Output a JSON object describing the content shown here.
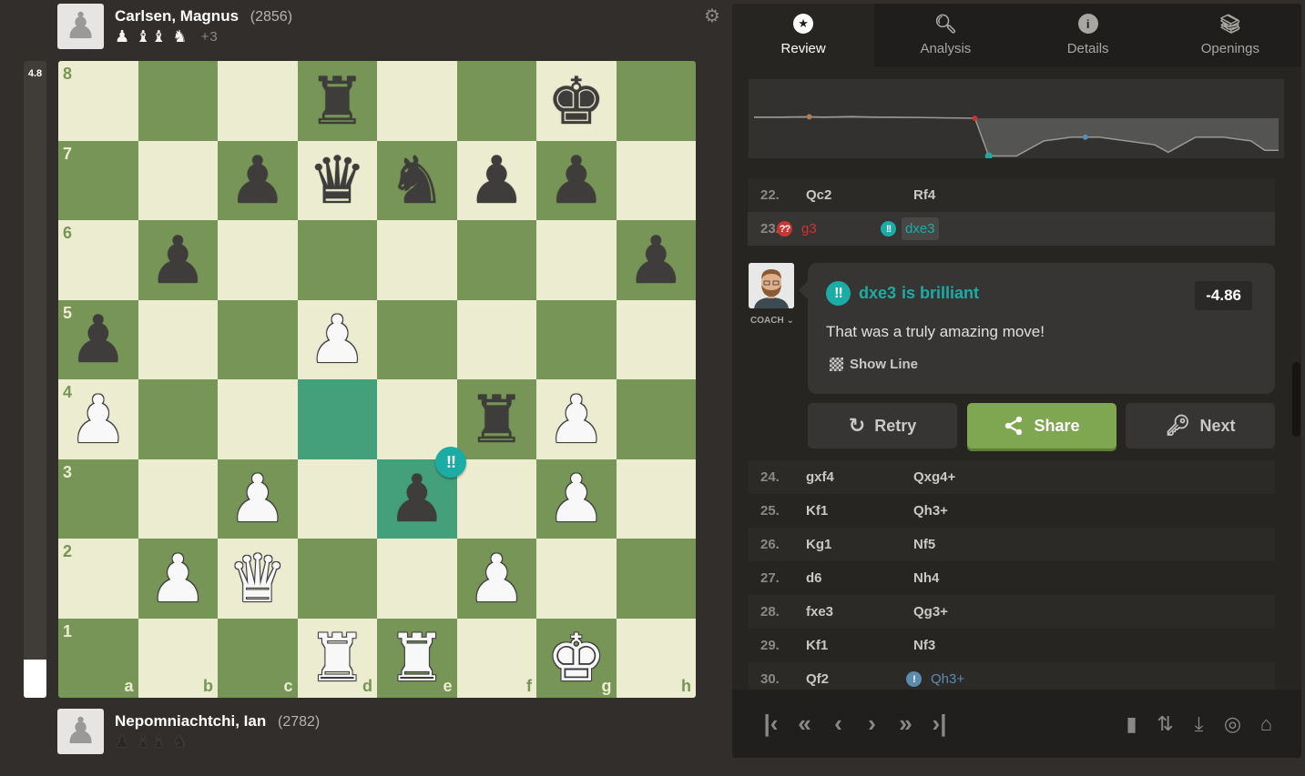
{
  "players": {
    "top": {
      "name": "Carlsen, Magnus",
      "rating": "(2856)",
      "captured": [
        "pawn",
        "bishops",
        "knight"
      ],
      "captured_glyphs": [
        "♟",
        "♝♝",
        "♞"
      ],
      "advantage": "+3"
    },
    "bottom": {
      "name": "Nepomniachtchi, Ian",
      "rating": "(2782)",
      "captured": [
        "pawn",
        "bishops",
        "knight"
      ],
      "captured_glyphs": [
        "♟",
        "♝♝",
        "♞"
      ]
    }
  },
  "eval_bar": {
    "label": "4.8",
    "white_fraction": 0.06
  },
  "board": {
    "files": [
      "a",
      "b",
      "c",
      "d",
      "e",
      "f",
      "g",
      "h"
    ],
    "ranks": [
      "8",
      "7",
      "6",
      "5",
      "4",
      "3",
      "2",
      "1"
    ],
    "highlight_squares": [
      "d4",
      "e3"
    ],
    "move_badge": {
      "square": "e3",
      "glyph": "!!",
      "type": "brilliant"
    },
    "pieces": {
      "d8": "bR",
      "g8": "bK",
      "c7": "bP",
      "d7": "bQ",
      "e7": "bN",
      "f7": "bP",
      "g7": "bP",
      "b6": "bP",
      "h6": "bP",
      "a5": "bP",
      "d5": "wP",
      "a4": "wP",
      "f4": "bR",
      "g4": "wP",
      "c3": "wP",
      "e3": "bP",
      "g3": "wP",
      "b2": "wP",
      "c2": "wQ",
      "f2": "wP",
      "d1": "wR",
      "e1": "wR",
      "g1": "wK"
    }
  },
  "tabs": [
    {
      "label": "Review",
      "icon": "star-icon",
      "active": true
    },
    {
      "label": "Analysis",
      "icon": "magnifier-icon",
      "active": false
    },
    {
      "label": "Details",
      "icon": "info-icon",
      "active": false
    },
    {
      "label": "Openings",
      "icon": "book-stack-icon",
      "active": false
    }
  ],
  "moves_top": [
    {
      "num": "22.",
      "white": "Qc2",
      "black": "Rf4"
    },
    {
      "num": "23.",
      "white": "g3",
      "white_glyph": "??",
      "white_class": "blunder",
      "black": "dxe3",
      "black_glyph": "!!",
      "black_class": "brilliant",
      "selected": "black"
    }
  ],
  "coach": {
    "label": "COACH",
    "title_move": "dxe3",
    "title_text": "is brilliant",
    "glyph": "!!",
    "eval": "-4.86",
    "message": "That was a truly amazing move!",
    "show_line": "Show Line"
  },
  "actions": {
    "retry": "Retry",
    "share": "Share",
    "next": "Next"
  },
  "moves_bottom": [
    {
      "num": "24.",
      "white": "gxf4",
      "black": "Qxg4+"
    },
    {
      "num": "25.",
      "white": "Kf1",
      "black": "Qh3+"
    },
    {
      "num": "26.",
      "white": "Kg1",
      "black": "Nf5"
    },
    {
      "num": "27.",
      "white": "d6",
      "black": "Nh4"
    },
    {
      "num": "28.",
      "white": "fxe3",
      "black": "Qg3+"
    },
    {
      "num": "29.",
      "white": "Kf1",
      "black": "Nf3"
    },
    {
      "num": "30.",
      "white": "Qf2",
      "black": "Qh3+",
      "black_glyph": "!",
      "black_class": "great"
    }
  ],
  "colors": {
    "brilliant": "#1baca6",
    "blunder": "#ca3431",
    "great": "#5c8bb0",
    "share_green": "#7fa650",
    "light_square": "#ebecd0",
    "dark_square": "#779556",
    "highlight": "#44a07a"
  },
  "eval_graph": {
    "points": [
      0.3,
      0.3,
      0.3,
      0.35,
      0.4,
      0.3,
      0.35,
      0.45,
      0.35,
      0.3,
      0.3,
      0.25,
      0.2,
      0.15,
      0.1,
      0.05,
      0.0,
      -10,
      -10,
      -10,
      -8,
      -6,
      -5.5,
      -5,
      -5,
      -5,
      -5.5,
      -6,
      -6.5,
      -7,
      -9,
      -7,
      -5,
      -5,
      -5,
      -5.5,
      -6,
      -8.5,
      -8.5
    ],
    "markers": [
      {
        "index": 4,
        "type": "inaccuracy",
        "color": "#b07b4f"
      },
      {
        "index": 16,
        "type": "blunder",
        "color": "#ca3431"
      },
      {
        "index": 17,
        "type": "brilliant",
        "color": "#1baca6"
      },
      {
        "index": 24,
        "type": "great",
        "color": "#5c8bb0"
      }
    ]
  },
  "footer": {
    "nav": [
      {
        "name": "first-move-button",
        "glyph": "|‹"
      },
      {
        "name": "back-5-button",
        "glyph": "«"
      },
      {
        "name": "prev-move-button",
        "glyph": "‹"
      },
      {
        "name": "next-move-button",
        "glyph": "›"
      },
      {
        "name": "forward-5-button",
        "glyph": "»"
      },
      {
        "name": "last-move-button",
        "glyph": "›|"
      }
    ],
    "tools": [
      {
        "name": "stats-icon",
        "glyph": "▮"
      },
      {
        "name": "flip-board-icon",
        "glyph": "⇅"
      },
      {
        "name": "download-icon",
        "glyph": "⤓"
      },
      {
        "name": "target-icon",
        "glyph": "◎"
      },
      {
        "name": "add-library-icon",
        "glyph": "⌂"
      }
    ]
  }
}
